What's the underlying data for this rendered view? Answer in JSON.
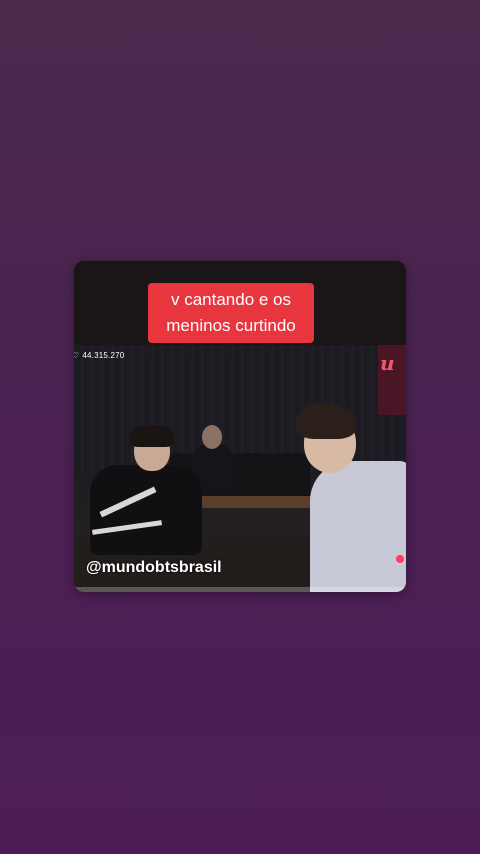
{
  "caption": {
    "line1": "v cantando e os",
    "line2": "meninos curtindo"
  },
  "video": {
    "likes_count": "44.315.270",
    "brand_logo": "u",
    "watermark": "@mundobtsbrasil",
    "progress": 0.0
  },
  "icons": {
    "likes": "heart-outline-icon",
    "brand": "brand-logo-icon"
  },
  "colors": {
    "caption_bg": "#e8363f",
    "background_top": "#4a2a4d",
    "background_bottom": "#4e1d58",
    "brand": "#f05a6e"
  }
}
